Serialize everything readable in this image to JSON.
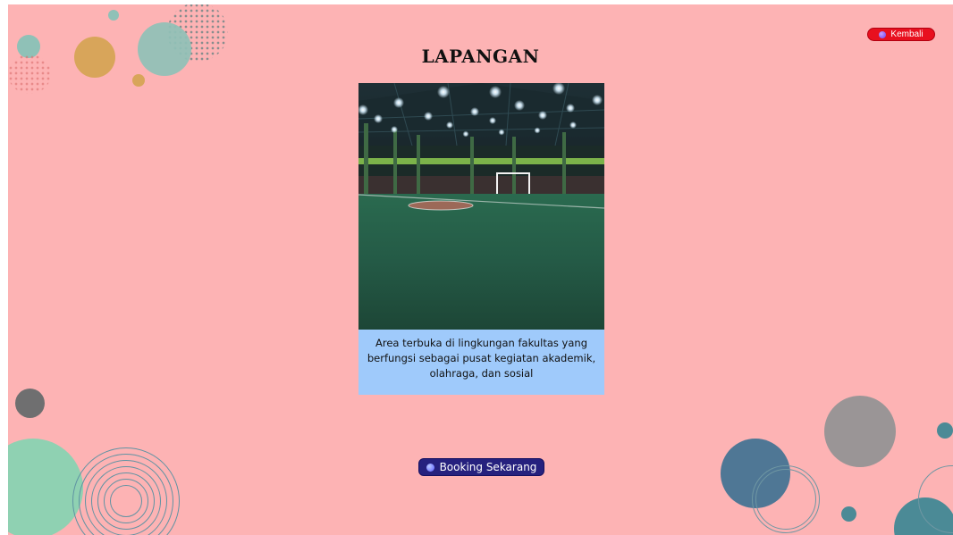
{
  "header": {
    "back_label": "Kembali",
    "back_icon": "bullet-dot-icon",
    "title": "LAPANGAN"
  },
  "card": {
    "image_subject": "futsal-court-photo",
    "description": "Area terbuka di lingkungan fakultas yang berfungsi sebagai pusat kegiatan akademik, olahraga, dan sosial"
  },
  "footer": {
    "booking_label": "Booking Sekarang",
    "booking_icon": "bullet-dot-icon"
  },
  "colors": {
    "background": "#fdb3b4",
    "back_button": "#e8101f",
    "booking_button": "#26217e",
    "description_panel": "#9fcafb"
  }
}
